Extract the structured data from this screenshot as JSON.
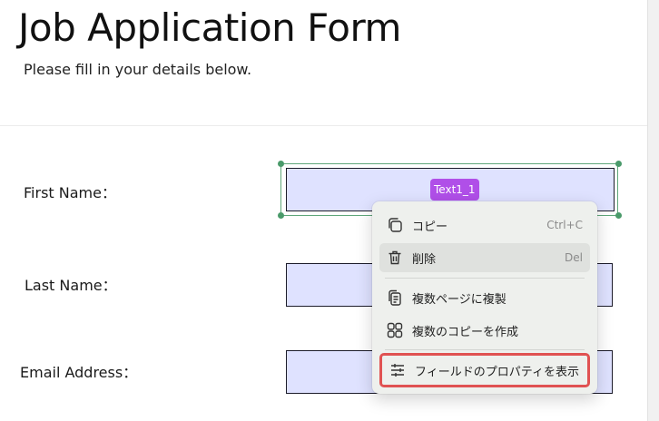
{
  "form": {
    "title": "Job Application Form",
    "subtitle": "Please fill in your details below.",
    "fields": [
      {
        "label": "First Name：",
        "tag": "Text1_1"
      },
      {
        "label": "Last Name："
      },
      {
        "label": "Email Address："
      }
    ]
  },
  "context_menu": {
    "items": [
      {
        "icon": "copy-icon",
        "label": "コピー",
        "shortcut": "Ctrl+C"
      },
      {
        "icon": "trash-icon",
        "label": "削除",
        "shortcut": "Del"
      },
      {
        "icon": "duplicate-pages-icon",
        "label": "複数ページに複製",
        "shortcut": ""
      },
      {
        "icon": "grid-copies-icon",
        "label": "複数のコピーを作成",
        "shortcut": ""
      },
      {
        "icon": "sliders-icon",
        "label": "フィールドのプロパティを表示",
        "shortcut": ""
      }
    ]
  },
  "colors": {
    "field_fill": "#dfe2ff",
    "tag": "#b04fe8",
    "selection": "#5fa77a",
    "highlight_outline": "#e05252"
  }
}
